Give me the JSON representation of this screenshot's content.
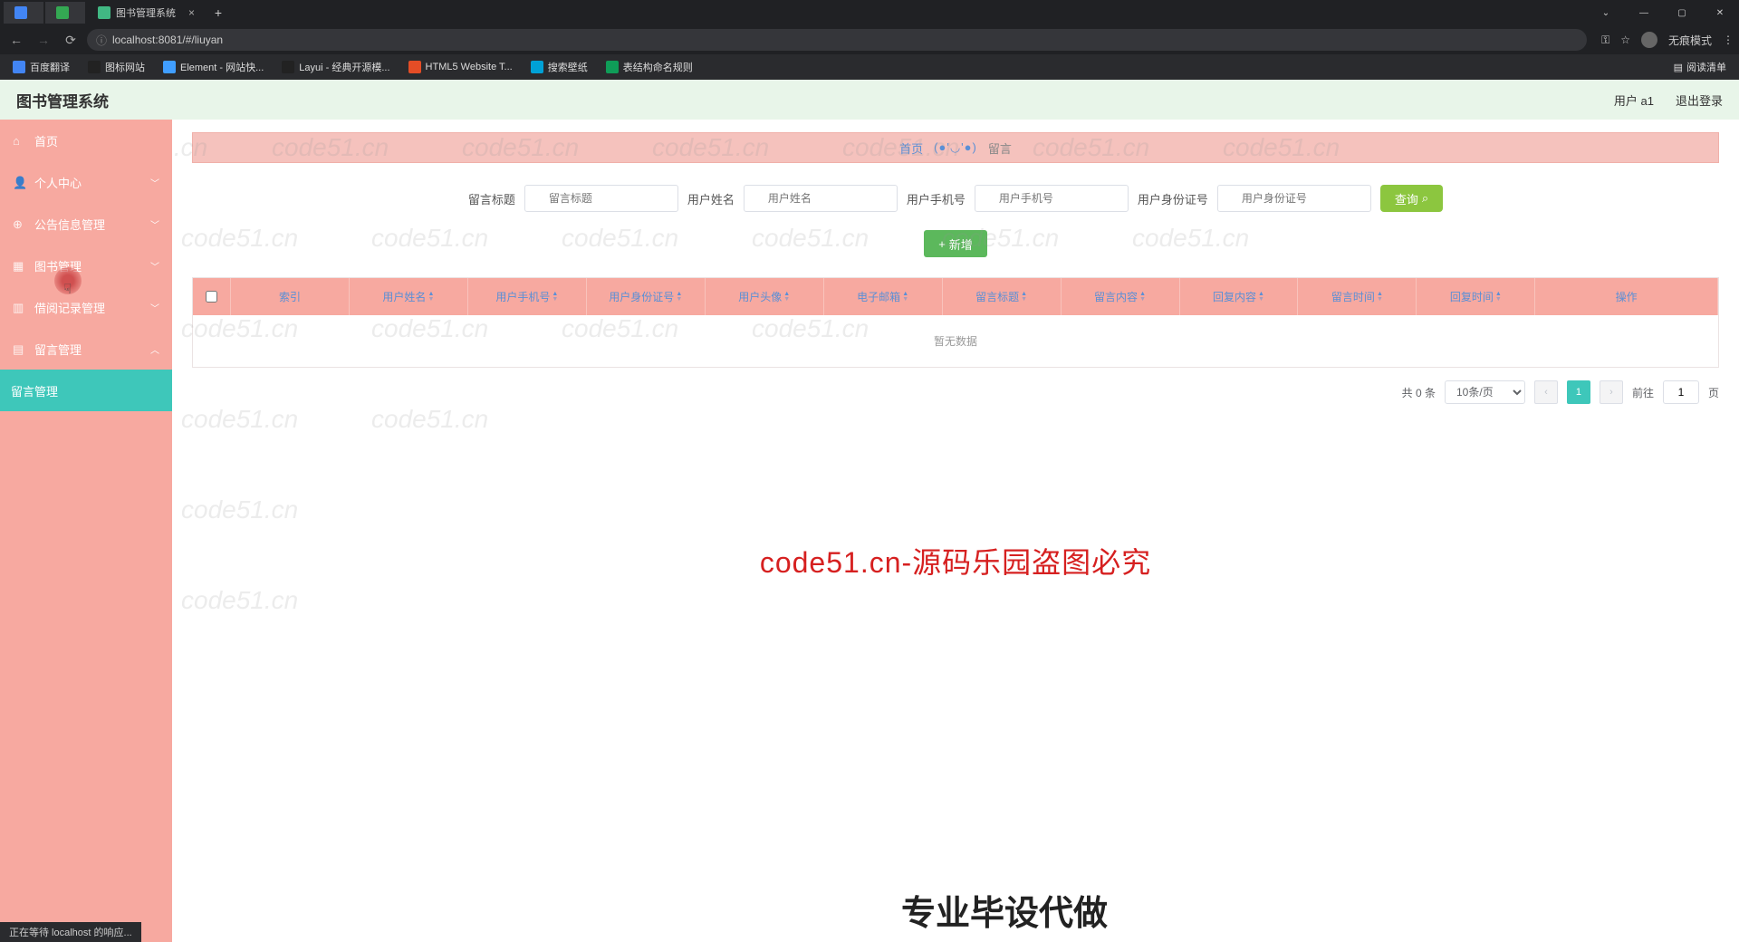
{
  "browser": {
    "tab_title": "图书管理系统",
    "address": "localhost:8081/#/liuyan",
    "incognito_label": "无痕模式",
    "reading_list": "阅读清单",
    "bookmarks": [
      "百度翻译",
      "图标网站",
      "Element - 网站快...",
      "Layui - 经典开源模...",
      "HTML5 Website T...",
      "搜索壁纸",
      "表结构命名规则"
    ]
  },
  "header": {
    "title": "图书管理系统",
    "user": "用户 a1",
    "logout": "退出登录"
  },
  "sidebar": {
    "items": [
      {
        "label": "首页",
        "icon": "home"
      },
      {
        "label": "个人中心",
        "icon": "user",
        "expand": true
      },
      {
        "label": "公告信息管理",
        "icon": "globe",
        "expand": true
      },
      {
        "label": "图书管理",
        "icon": "book",
        "expand": true
      },
      {
        "label": "借阅记录管理",
        "icon": "clip",
        "expand": true
      },
      {
        "label": "留言管理",
        "icon": "msg",
        "expand": true
      }
    ],
    "sub_active": "留言管理"
  },
  "crumb": {
    "home": "首页",
    "face": "(●'◡'●)",
    "current": "留言"
  },
  "filters": [
    {
      "label": "留言标题",
      "placeholder": "留言标题"
    },
    {
      "label": "用户姓名",
      "placeholder": "用户姓名"
    },
    {
      "label": "用户手机号",
      "placeholder": "用户手机号"
    },
    {
      "label": "用户身份证号",
      "placeholder": "用户身份证号"
    }
  ],
  "buttons": {
    "search": "查询",
    "add": "新增"
  },
  "table": {
    "cols": [
      "索引",
      "用户姓名",
      "用户手机号",
      "用户身份证号",
      "用户头像",
      "电子邮箱",
      "留言标题",
      "留言内容",
      "回复内容",
      "留言时间",
      "回复时间",
      "操作"
    ],
    "empty": "暂无数据"
  },
  "pager": {
    "total": "共 0 条",
    "size": "10条/页",
    "page": "1",
    "goto_prefix": "前往",
    "goto_page": "1",
    "goto_suffix": "页"
  },
  "watermark": "code51.cn",
  "overlay_red": "code51.cn-源码乐园盗图必究",
  "overlay_black": "专业毕设代做",
  "status": "正在等待 localhost 的响应..."
}
